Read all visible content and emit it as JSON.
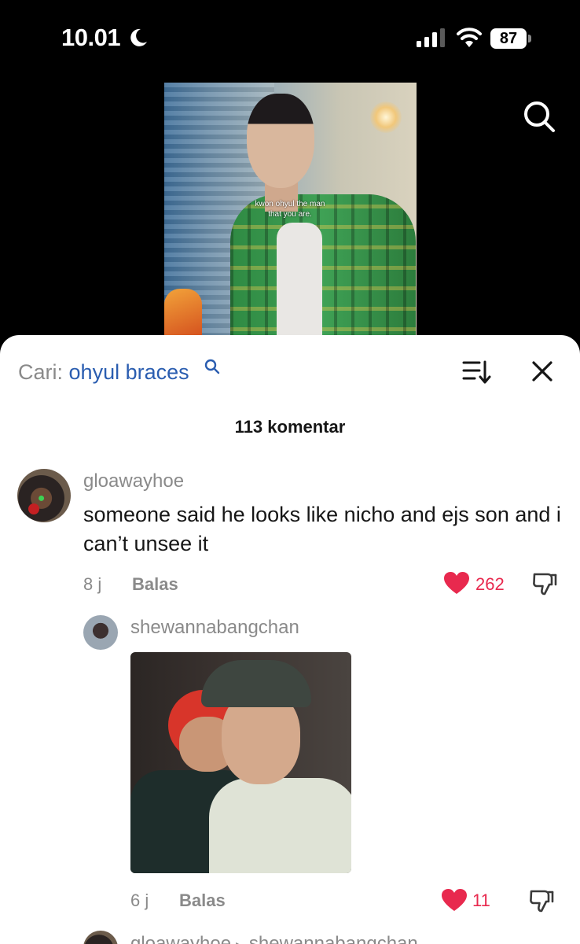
{
  "status_bar": {
    "time": "10.01",
    "battery": "87"
  },
  "video": {
    "caption_line1": "kwon ohyul the man",
    "caption_line2": "that you are."
  },
  "comments_sheet": {
    "search_label": "Cari:",
    "search_query": "ohyul braces",
    "count_label": "113 komentar",
    "comments": [
      {
        "username": "gloawayhoe",
        "text": "someone said he looks like nicho and ejs son and i can’t unsee it",
        "time": "8 j",
        "reply_label": "Balas",
        "likes": "262"
      },
      {
        "username": "shewannabangchan",
        "time": "6 j",
        "reply_label": "Balas",
        "likes": "11"
      },
      {
        "username": "gloawayhoe",
        "reply_to": "shewannabangchan"
      }
    ]
  },
  "colors": {
    "accent_blue": "#2a5db0",
    "like_red": "#e8294e",
    "muted_gray": "#8a8a8a"
  },
  "icons": [
    "moon-icon",
    "signal-icon",
    "wifi-icon",
    "search-icon",
    "sort-icon",
    "close-icon",
    "heart-icon",
    "dislike-icon"
  ]
}
